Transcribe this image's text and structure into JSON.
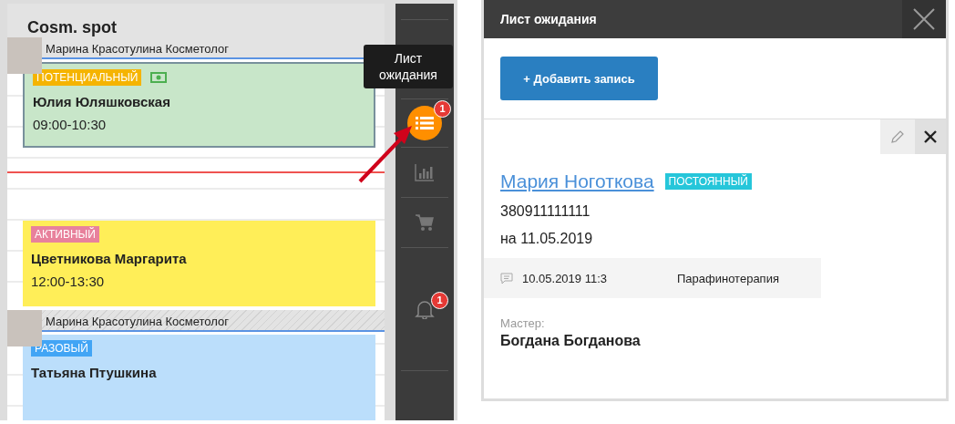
{
  "calendar": {
    "title": "Cosm. spot",
    "appointments": [
      {
        "master": "Марина Красотулина Косметолог",
        "status": "ПОТЕНЦИАЛЬНЫЙ",
        "kind": "potential",
        "paid": true,
        "client": "Юлия Юляшковская",
        "time": "09:00-10:30"
      },
      {
        "status": "АКТИВНЫЙ",
        "kind": "active",
        "paid": false,
        "client": "Цветникова Маргарита",
        "time": "12:00-13:30"
      },
      {
        "master": "Марина Красотулина Косметолог",
        "status": "РАЗОВЫЙ",
        "kind": "once",
        "paid": false,
        "client": "Татьяна Птушкина"
      }
    ]
  },
  "sidebar": {
    "tooltip": "Лист ожидания",
    "waitlist_badge": "1",
    "notifications_badge": "1"
  },
  "waitlist": {
    "title": "Лист ожидания",
    "add_button": "+ Добавить запись",
    "entry": {
      "client": "Мария Ноготкова",
      "status": "ПОСТОЯННЫЙ",
      "phone": "380911111111",
      "date": "на 11.05.2019",
      "created": "10.05.2019 11:3",
      "service": "Парафинотерапия",
      "master_label": "Мастер:",
      "master": "Богдана Богданова"
    }
  }
}
